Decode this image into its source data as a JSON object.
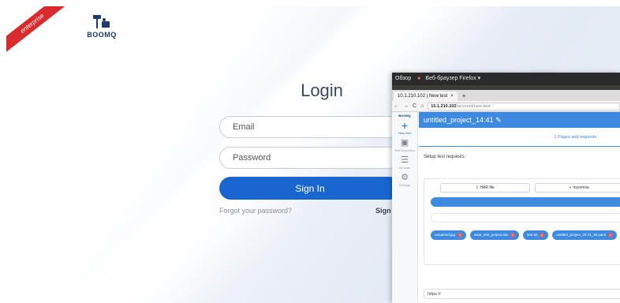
{
  "login": {
    "ribbon": "enterprise",
    "logo_text": "BOOMQ",
    "title": "Login",
    "email_placeholder": "Email",
    "password_placeholder": "Password",
    "signin_label": "Sign In",
    "forgot_label": "Forgot your password?",
    "signup_label": "Sign"
  },
  "os": {
    "overview_label": "Обзор",
    "app_label": "Веб-браузер Firefox ▾"
  },
  "browser": {
    "tab_title": "10.1.210.102 | New test",
    "tab_close": "×",
    "new_tab": "+",
    "back": "←",
    "forward": "→",
    "reload": "C",
    "home": "⌂",
    "url_host": "10.1.210.102",
    "url_path": "/account/new-test"
  },
  "app": {
    "sidebar": [
      {
        "label": "New test",
        "icon": "plus-icon",
        "glyph": "+"
      },
      {
        "label": "Test templates",
        "icon": "templates-icon",
        "glyph": "▣"
      },
      {
        "label": "All tests",
        "icon": "list-icon",
        "glyph": "☰"
      },
      {
        "label": "Settings",
        "icon": "gear-icon",
        "glyph": "⚙"
      }
    ],
    "sidebar_logo": "BOOMQ",
    "project_title": "untitled_project_14:41 ✎",
    "step_label": "1  Pages and requests",
    "setup_title": "Setup test requests",
    "har_button": "HAR file",
    "insomnia_button": "Insomnia",
    "files": [
      "unnamed.jpg",
      "save_test_project.har",
      "test.txt",
      "untitled_project_20 31_30.yaml"
    ],
    "url_value": "https://"
  },
  "colors": {
    "accent": "#1a66d1",
    "header": "#3d8ae0",
    "ribbon": "#d92b2b"
  }
}
